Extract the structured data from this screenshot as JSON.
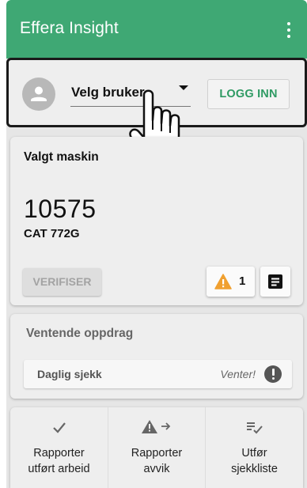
{
  "appbar": {
    "title": "Effera Insight",
    "menu_icon": "more-vert-icon",
    "color": "#3fa874"
  },
  "login": {
    "user_select_label": "Velg bruker",
    "login_button": "LOGG INN",
    "avatar_icon": "person-icon"
  },
  "machine": {
    "section_title": "Valgt maskin",
    "number": "10575",
    "model": "CAT 772G",
    "verify_button": "VERIFISER",
    "warning_count": "1",
    "warning_icon": "warning-icon",
    "warning_color": "#f0a030",
    "notes_icon": "notes-icon"
  },
  "pending": {
    "section_title": "Ventende oppdrag",
    "tasks": [
      {
        "name": "Daglig sjekk",
        "status": "Venter!"
      }
    ]
  },
  "actions": [
    {
      "label": "Rapporter\nutført arbeid",
      "icon": "check-icon"
    },
    {
      "label": "Rapporter\navvik",
      "icon": "report-deviation-icon"
    },
    {
      "label": "Utfør\nsjekkliste",
      "icon": "checklist-icon"
    }
  ]
}
